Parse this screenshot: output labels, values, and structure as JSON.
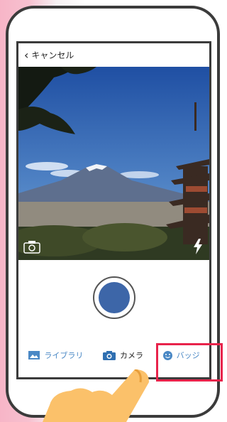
{
  "header": {
    "back_label": "キャンセル"
  },
  "tabs": [
    {
      "label": "ライブラリ",
      "icon": "image-icon"
    },
    {
      "label": "カメラ",
      "icon": "camera-icon"
    },
    {
      "label": "バッジ",
      "icon": "smiley-icon"
    }
  ],
  "colors": {
    "accent": "#4a88c5",
    "shutter": "#3d66a8",
    "highlight": "#e8234b"
  }
}
